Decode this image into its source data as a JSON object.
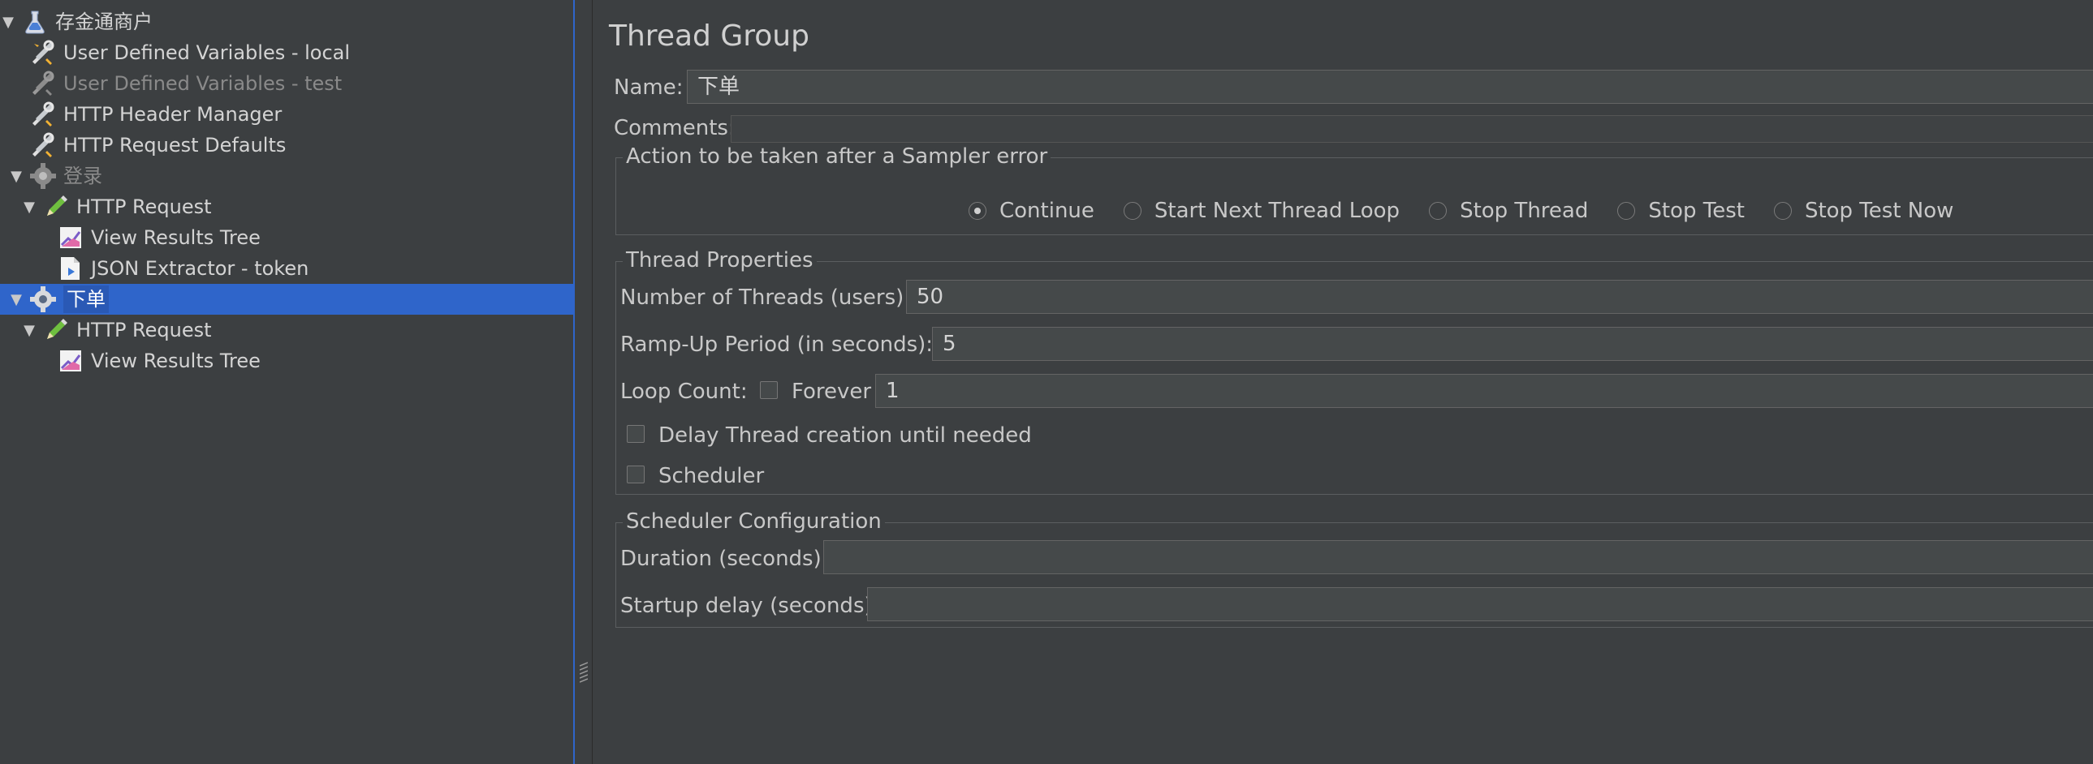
{
  "tree": {
    "items": [
      {
        "label": "存金通商户",
        "icon": "test-plan-icon",
        "toggle": "▼",
        "disabled": false,
        "selected": false
      },
      {
        "label": "User Defined Variables - local",
        "icon": "config-wrench-icon",
        "toggle": "",
        "disabled": false,
        "selected": false
      },
      {
        "label": "User Defined Variables - test",
        "icon": "config-wrench-icon",
        "toggle": "",
        "disabled": true,
        "selected": false
      },
      {
        "label": "HTTP Header Manager",
        "icon": "config-wrench-icon",
        "toggle": "",
        "disabled": false,
        "selected": false
      },
      {
        "label": "HTTP Request Defaults",
        "icon": "config-wrench-icon",
        "toggle": "",
        "disabled": false,
        "selected": false
      },
      {
        "label": "登录",
        "icon": "thread-group-gear-icon",
        "toggle": "▼",
        "disabled": true,
        "selected": false
      },
      {
        "label": "HTTP Request",
        "icon": "sampler-pen-icon",
        "toggle": "▼",
        "disabled": false,
        "selected": false
      },
      {
        "label": "View Results Tree",
        "icon": "listener-chart-icon",
        "toggle": "",
        "disabled": false,
        "selected": false
      },
      {
        "label": "JSON Extractor - token",
        "icon": "extractor-doc-icon",
        "toggle": "",
        "disabled": false,
        "selected": false
      },
      {
        "label": "下单",
        "icon": "thread-group-gear-icon",
        "toggle": "▼",
        "disabled": false,
        "selected": true
      },
      {
        "label": "HTTP Request",
        "icon": "sampler-pen-icon",
        "toggle": "▼",
        "disabled": false,
        "selected": false
      },
      {
        "label": "View Results Tree",
        "icon": "listener-chart-icon",
        "toggle": "",
        "disabled": false,
        "selected": false
      }
    ]
  },
  "panel": {
    "title": "Thread Group",
    "name_label": "Name:",
    "name_value": "下单",
    "comments_label": "Comments:",
    "comments_value": "",
    "sampler_error": {
      "title": "Action to be taken after a Sampler error",
      "options": [
        "Continue",
        "Start Next Thread Loop",
        "Stop Thread",
        "Stop Test",
        "Stop Test Now"
      ],
      "selected": "Continue"
    },
    "thread_props": {
      "title": "Thread Properties",
      "threads_label": "Number of Threads (users):",
      "threads_value": "50",
      "rampup_label": "Ramp-Up Period (in seconds):",
      "rampup_value": "5",
      "loop_label": "Loop Count:",
      "forever_label": "Forever",
      "forever_checked": false,
      "loop_value": "1",
      "delay_label": "Delay Thread creation until needed",
      "delay_checked": false,
      "scheduler_label": "Scheduler",
      "scheduler_checked": false
    },
    "scheduler_config": {
      "title": "Scheduler Configuration",
      "duration_label": "Duration (seconds)",
      "duration_value": "",
      "startup_label": "Startup delay (seconds)",
      "startup_value": ""
    }
  },
  "colors": {
    "background": "#3c3f41",
    "selection": "#2f65ca",
    "field": "#45494a"
  }
}
